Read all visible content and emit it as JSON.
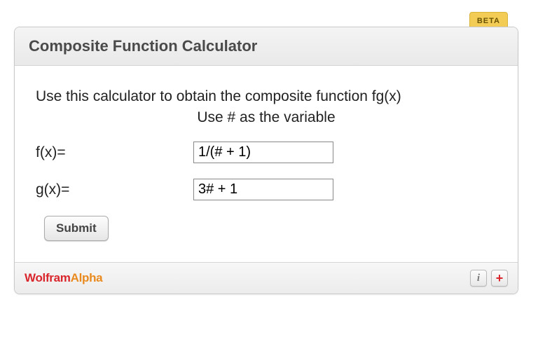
{
  "badge": "BETA",
  "title": "Composite Function Calculator",
  "intro": "Use this calculator to obtain the composite function fg(x)",
  "hint": "Use # as the variable",
  "fields": {
    "f": {
      "label": "f(x)=",
      "value": "1/(# + 1)"
    },
    "g": {
      "label": "g(x)=",
      "value": "3# + 1"
    }
  },
  "submit_label": "Submit",
  "footer": {
    "brand1": "Wolfram",
    "brand2": "Alpha",
    "info_glyph": "i",
    "plus_glyph": "+"
  }
}
